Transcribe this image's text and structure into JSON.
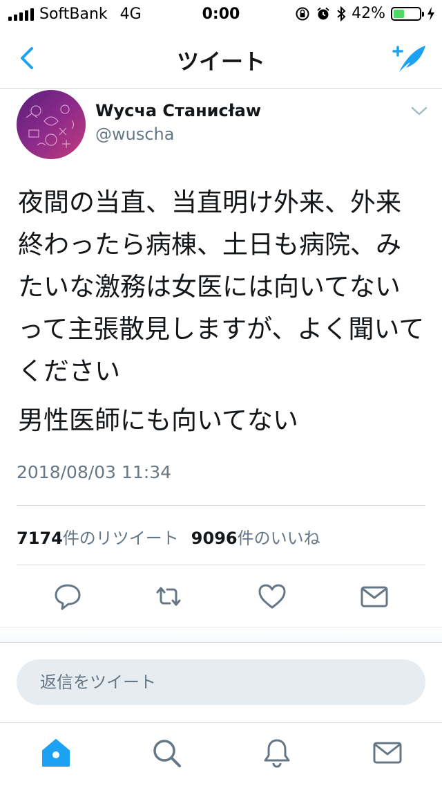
{
  "status_bar": {
    "carrier": "SoftBank",
    "network": "4G",
    "time": "0:00",
    "battery_percent": "42%",
    "battery_level": 0.42
  },
  "nav": {
    "title": "ツイート",
    "back_icon": "chevron-left-icon",
    "compose_icon": "compose-tweet-icon"
  },
  "tweet": {
    "author_name": "Wycча Станисław",
    "author_handle": "@wuscha",
    "paragraphs": [
      "夜間の当直、当直明け外来、外来終わったら病棟、土日も病院、みたいな激務は女医には向いてないって主張散見しますが、よく聞いてください",
      "男性医師にも向いてない"
    ],
    "timestamp": "2018/08/03 11:34",
    "retweet_count": "7174",
    "retweet_label": "件のリツイート",
    "like_count": "9096",
    "like_label": "件のいいね"
  },
  "actions": [
    "reply-icon",
    "retweet-icon",
    "like-icon",
    "dm-icon"
  ],
  "reply": {
    "placeholder": "返信をツイート"
  },
  "tabs": [
    "home-icon",
    "search-icon",
    "notifications-icon",
    "messages-icon"
  ],
  "colors": {
    "accent": "#1da1f2",
    "secondary_text": "#657786",
    "icon_gray": "#657786"
  }
}
